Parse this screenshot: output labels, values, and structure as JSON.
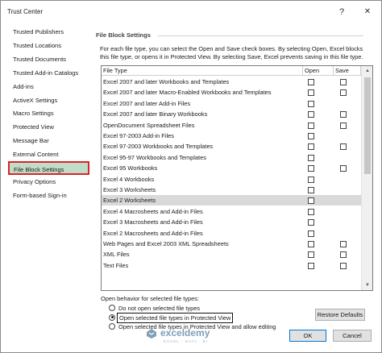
{
  "window": {
    "title": "Trust Center",
    "help_glyph": "?",
    "close_glyph": "✕"
  },
  "sidebar": {
    "items": [
      {
        "label": "Trusted Publishers"
      },
      {
        "label": "Trusted Locations"
      },
      {
        "label": "Trusted Documents"
      },
      {
        "label": "Trusted Add-in Catalogs"
      },
      {
        "label": "Add-ins"
      },
      {
        "label": "ActiveX Settings"
      },
      {
        "label": "Macro Settings"
      },
      {
        "label": "Protected View"
      },
      {
        "label": "Message Bar"
      },
      {
        "label": "External Content"
      },
      {
        "label": "File Block Settings"
      },
      {
        "label": "Privacy Options"
      },
      {
        "label": "Form-based Sign-in"
      }
    ],
    "selected_index": 10
  },
  "main": {
    "section_title": "File Block Settings",
    "description": "For each file type, you can select the Open and Save check boxes. By selecting Open, Excel blocks this file type, or opens it in Protected View. By selecting Save, Excel prevents saving in this file type.",
    "table": {
      "columns": {
        "type": "File Type",
        "open": "Open",
        "save": "Save"
      },
      "rows": [
        {
          "label": "Excel 2007 and later Workbooks and Templates",
          "open": false,
          "save": false
        },
        {
          "label": "Excel 2007 and later Macro-Enabled Workbooks and Templates",
          "open": false,
          "save": false
        },
        {
          "label": "Excel 2007 and later Add-in Files",
          "open": false,
          "save": null
        },
        {
          "label": "Excel 2007 and later Binary Workbooks",
          "open": false,
          "save": false
        },
        {
          "label": "OpenDocument Spreadsheet Files",
          "open": false,
          "save": false
        },
        {
          "label": "Excel 97-2003 Add-in Files",
          "open": false,
          "save": null
        },
        {
          "label": "Excel 97-2003 Workbooks and Templates",
          "open": false,
          "save": false
        },
        {
          "label": "Excel 95-97 Workbooks and Templates",
          "open": false,
          "save": null
        },
        {
          "label": "Excel 95 Workbooks",
          "open": false,
          "save": false
        },
        {
          "label": "Excel 4 Workbooks",
          "open": false,
          "save": null
        },
        {
          "label": "Excel 3 Worksheets",
          "open": false,
          "save": null
        },
        {
          "label": "Excel 2 Worksheets",
          "open": false,
          "save": null
        },
        {
          "label": "Excel 4 Macrosheets and Add-in Files",
          "open": false,
          "save": null
        },
        {
          "label": "Excel 3 Macrosheets and Add-in Files",
          "open": false,
          "save": null
        },
        {
          "label": "Excel 2 Macrosheets and Add-in Files",
          "open": false,
          "save": null
        },
        {
          "label": "Web Pages and Excel 2003 XML Spreadsheets",
          "open": false,
          "save": false
        },
        {
          "label": "XML Files",
          "open": false,
          "save": false
        },
        {
          "label": "Text Files",
          "open": false,
          "save": false
        }
      ],
      "selected_index": 11
    },
    "open_behavior": {
      "label": "Open behavior for selected file types:",
      "options": [
        {
          "label": "Do not open selected file types",
          "checked": false
        },
        {
          "label": "Open selected file types in Protected View",
          "checked": true
        },
        {
          "label": "Open selected file types in Protected View and allow editing",
          "checked": false
        }
      ]
    },
    "restore_label": "Restore Defaults"
  },
  "footer": {
    "ok_label": "OK",
    "cancel_label": "Cancel"
  },
  "watermark": {
    "name": "exceldemy",
    "tagline": "EXCEL · DATA · BI"
  },
  "colors": {
    "selected_nav_bg": "#c1ddc7",
    "selected_nav_border": "#d9242a",
    "selected_row_bg": "#d9d9d9",
    "ok_border": "#0078d7"
  }
}
